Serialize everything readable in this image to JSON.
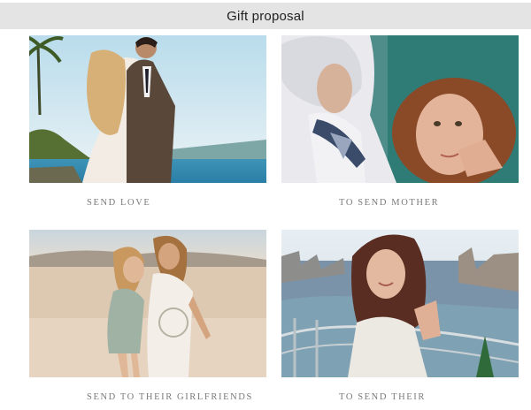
{
  "header": {
    "title": "Gift proposal"
  },
  "cards": [
    {
      "caption": "SEND LOVE",
      "image": "couple-on-beach-photo"
    },
    {
      "caption": "TO SEND MOTHER",
      "image": "mother-and-daughter-photo"
    },
    {
      "caption": "SEND TO THEIR GIRLFRIENDS",
      "image": "two-girlfriends-on-beach-photo"
    },
    {
      "caption": "TO SEND THEIR",
      "image": "woman-on-balcony-photo"
    }
  ],
  "colors": {
    "header_background": "#e4e4e4",
    "caption_text": "#7a7a7a"
  }
}
